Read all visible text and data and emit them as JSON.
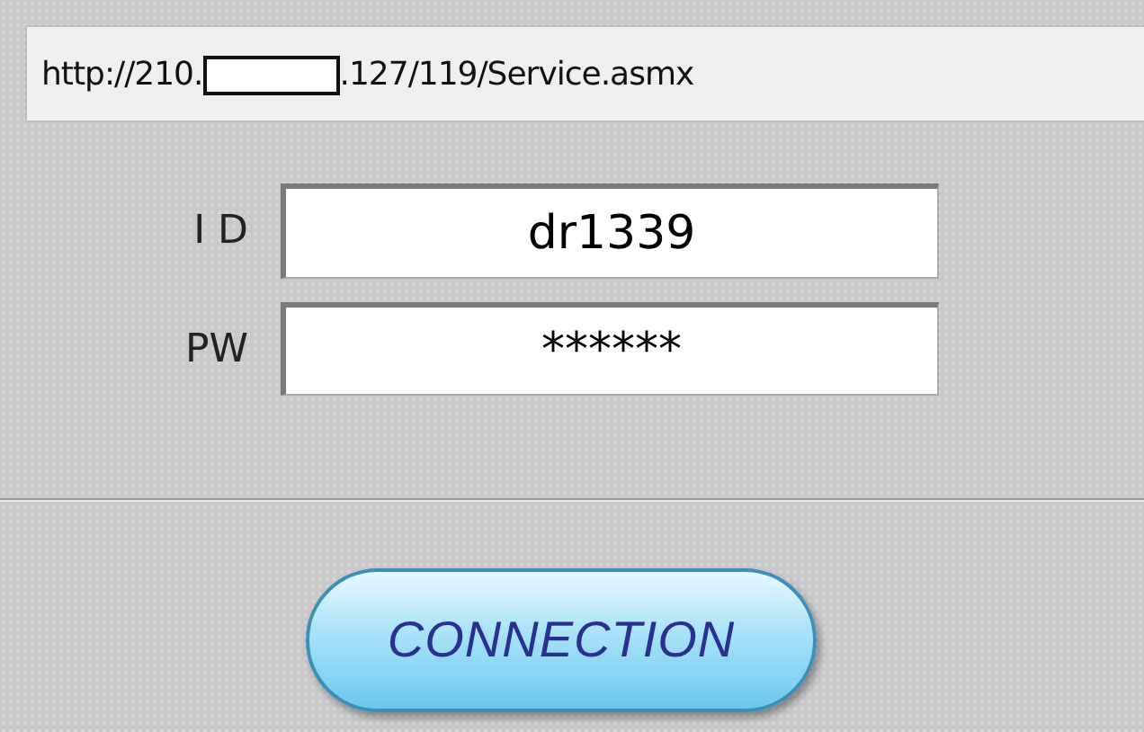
{
  "url_bar": {
    "prefix": "http://210.",
    "suffix": ".127/119/Service.asmx"
  },
  "fields": [
    {
      "label": "I D",
      "value": "dr1339"
    },
    {
      "label": "PW",
      "value": "******"
    }
  ],
  "button": {
    "label": "CONNECTION"
  }
}
